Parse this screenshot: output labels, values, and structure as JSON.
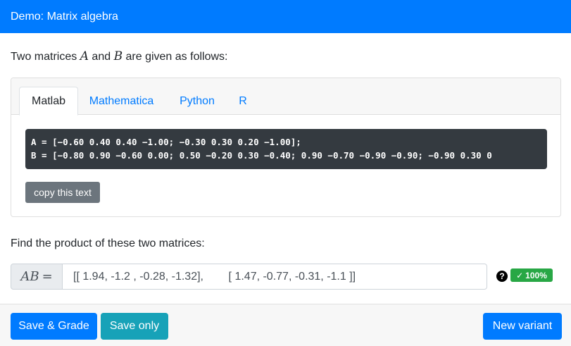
{
  "header": {
    "title": "Demo: Matrix algebra"
  },
  "intro": {
    "prefix": "Two matrices ",
    "var_a": "A",
    "and": " and ",
    "var_b": "B",
    "suffix": " are given as follows:"
  },
  "tabs": [
    {
      "label": "Matlab",
      "active": true
    },
    {
      "label": "Mathematica",
      "active": false
    },
    {
      "label": "Python",
      "active": false
    },
    {
      "label": "R",
      "active": false
    }
  ],
  "code": {
    "line_a": "A = [−0.60 0.40 0.40 −1.00; −0.30 0.30 0.20 −1.00];",
    "line_b": "B = [−0.80 0.90 −0.60 0.00; 0.50 −0.20 0.30 −0.40; 0.90 −0.70 −0.90 −0.90; −0.90 0.30 0"
  },
  "copy_button": {
    "label": "copy this text"
  },
  "question": {
    "text": "Find the product of these two matrices:"
  },
  "answer": {
    "prefix_var": "AB",
    "prefix_eq": "=",
    "value": "[[ 1.94, -1.2 , -0.28, -1.32],        [ 1.47, -0.77, -0.31, -1.1 ]]"
  },
  "help": {
    "icon": "question-circle-icon",
    "glyph": "?"
  },
  "score": {
    "check": "✓",
    "label": "100%",
    "color": "#28a745"
  },
  "footer": {
    "save_grade": "Save & Grade",
    "save_only": "Save only",
    "new_variant": "New variant"
  },
  "colors": {
    "primary": "#007bff",
    "info": "#17a2b8",
    "secondary": "#6c757d",
    "code_bg": "#343a40"
  }
}
